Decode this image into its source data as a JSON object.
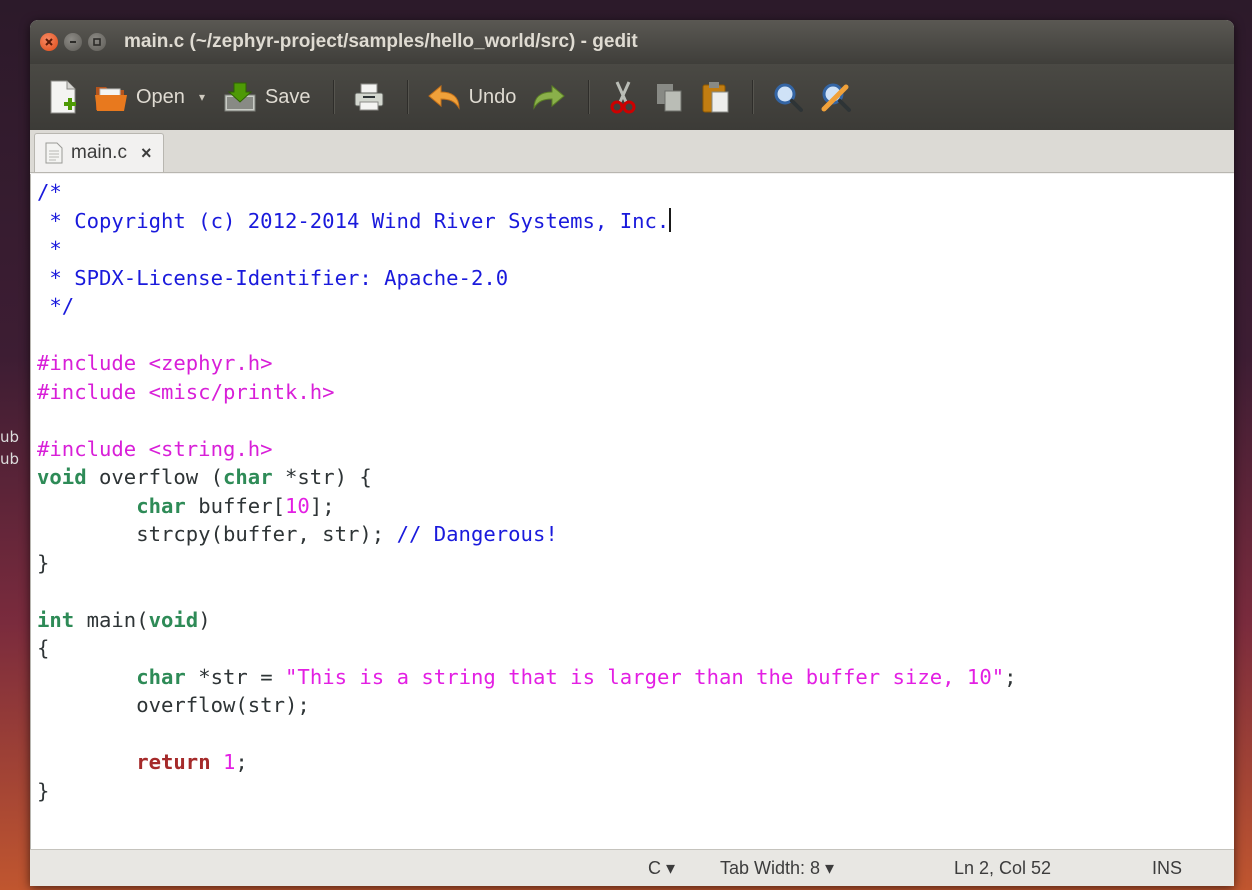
{
  "desktop": {
    "labels": [
      "ub",
      "ub"
    ]
  },
  "window": {
    "title": "main.c (~/zephyr-project/samples/hello_world/src) - gedit"
  },
  "toolbar": {
    "open_label": "Open",
    "open_arrow": "▾",
    "save_label": "Save",
    "undo_label": "Undo"
  },
  "tabs": [
    {
      "label": "main.c",
      "close": "×"
    }
  ],
  "editor": {
    "lines": [
      [
        {
          "t": "cm",
          "s": "/*"
        }
      ],
      [
        {
          "t": "cm",
          "s": " * Copyright (c) 2012-2014 Wind River Systems, Inc."
        },
        {
          "t": "cursor",
          "s": ""
        }
      ],
      [
        {
          "t": "cm",
          "s": " *"
        }
      ],
      [
        {
          "t": "cm",
          "s": " * SPDX-License-Identifier: Apache-2.0"
        }
      ],
      [
        {
          "t": "cm",
          "s": " */"
        }
      ],
      [],
      [
        {
          "t": "pp",
          "s": "#include <zephyr.h>"
        }
      ],
      [
        {
          "t": "pp",
          "s": "#include <misc/printk.h>"
        }
      ],
      [],
      [
        {
          "t": "pp",
          "s": "#include <string.h>"
        }
      ],
      [
        {
          "t": "ty",
          "s": "void"
        },
        {
          "t": "",
          "s": " overflow ("
        },
        {
          "t": "ty",
          "s": "char"
        },
        {
          "t": "",
          "s": " *str) {"
        }
      ],
      [
        {
          "t": "",
          "s": "        "
        },
        {
          "t": "ty",
          "s": "char"
        },
        {
          "t": "",
          "s": " buffer["
        },
        {
          "t": "nm",
          "s": "10"
        },
        {
          "t": "",
          "s": "];"
        }
      ],
      [
        {
          "t": "",
          "s": "        strcpy(buffer, str); "
        },
        {
          "t": "cm",
          "s": "// Dangerous!"
        }
      ],
      [
        {
          "t": "",
          "s": "}"
        }
      ],
      [],
      [
        {
          "t": "ty",
          "s": "int"
        },
        {
          "t": "",
          "s": " main("
        },
        {
          "t": "ty",
          "s": "void"
        },
        {
          "t": "",
          "s": ")"
        }
      ],
      [
        {
          "t": "",
          "s": "{"
        }
      ],
      [
        {
          "t": "",
          "s": "        "
        },
        {
          "t": "ty",
          "s": "char"
        },
        {
          "t": "",
          "s": " *str = "
        },
        {
          "t": "st",
          "s": "\"This is a string that is larger than the buffer size, 10\""
        },
        {
          "t": "",
          "s": ";"
        }
      ],
      [
        {
          "t": "",
          "s": "        overflow(str);"
        }
      ],
      [],
      [
        {
          "t": "",
          "s": "        "
        },
        {
          "t": "kw",
          "s": "return"
        },
        {
          "t": "",
          "s": " "
        },
        {
          "t": "nm",
          "s": "1"
        },
        {
          "t": "",
          "s": ";"
        }
      ],
      [
        {
          "t": "",
          "s": "}"
        }
      ]
    ]
  },
  "statusbar": {
    "language": "C ▾",
    "tab_width": "Tab Width: 8 ▾",
    "position": "Ln 2, Col 52",
    "mode": "INS"
  },
  "colors": {
    "comment": "#1a1adc",
    "preprocessor": "#d81fd8",
    "type": "#2e8b57",
    "keyword": "#a52a2a",
    "string": "#e31fe3"
  }
}
